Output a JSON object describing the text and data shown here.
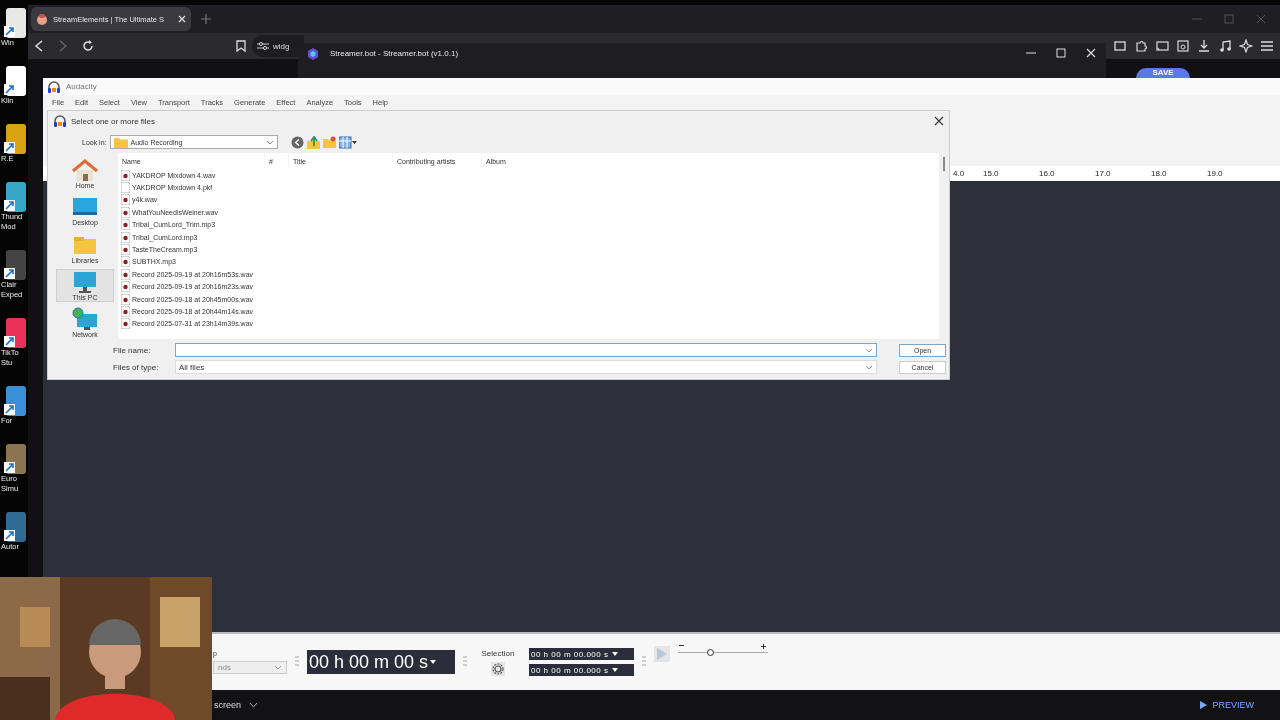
{
  "desktop_icons": [
    {
      "lines": [
        "Win"
      ]
    },
    {
      "lines": [
        "Klin"
      ]
    },
    {
      "lines": [
        "R.E"
      ]
    },
    {
      "lines": [
        "Thund",
        "Mod"
      ]
    },
    {
      "lines": [
        "Clair",
        "Exped"
      ]
    },
    {
      "lines": [
        "TikTo",
        "Stu"
      ]
    },
    {
      "lines": [
        "For"
      ]
    },
    {
      "lines": [
        "Euro",
        "Simu"
      ]
    },
    {
      "lines": [
        "Autor"
      ]
    }
  ],
  "browser": {
    "tab": {
      "title": "StreamElements | The Ultimate S",
      "selected": true
    },
    "address": "widg",
    "save_button": "SAVE",
    "screen_dropdown": "screen",
    "preview_button": "PREVIEW"
  },
  "streamerbot": {
    "title": "Streamer.bot - Streamer.bot (v1.0.1)"
  },
  "audacity": {
    "title": "Audacity",
    "menu": [
      "File",
      "Edit",
      "Select",
      "View",
      "Transport",
      "Tracks",
      "Generate",
      "Effect",
      "Analyze",
      "Tools",
      "Help"
    ],
    "ruler": [
      "4.0",
      "15.0",
      "16.0",
      "17.0",
      "18.0",
      "19.0"
    ],
    "toolbar": {
      "snap_label": "p",
      "snap_value": "nds",
      "time": "00 h 00 m 00 s",
      "selection_label": "Selection",
      "selection_start": "00 h 00 m 00.000 s",
      "selection_end": "00 h 00 m 00.000 s",
      "play_speed": {
        "level": 0.35
      }
    }
  },
  "dialog": {
    "title": "Select one or more files",
    "look_in_label": "Look in:",
    "folder": "Audio Recording",
    "places": [
      {
        "label": "Home",
        "kind": "home",
        "selected": false
      },
      {
        "label": "Desktop",
        "kind": "desktop",
        "selected": false
      },
      {
        "label": "Libraries",
        "kind": "libraries",
        "selected": false
      },
      {
        "label": "This PC",
        "kind": "pc",
        "selected": true
      },
      {
        "label": "Network",
        "kind": "network",
        "selected": false
      }
    ],
    "columns": [
      "Name",
      "#",
      "Title",
      "Contributing artists",
      "Album"
    ],
    "files": [
      {
        "name": "YAKDROP Mixdown 4.wav",
        "kind": "audio"
      },
      {
        "name": "YAKDROP Mixdown 4.pkf",
        "kind": "plain"
      },
      {
        "name": "y4k.wav",
        "kind": "audio"
      },
      {
        "name": "WhatYouNeedisWeiner.wav",
        "kind": "audio"
      },
      {
        "name": "Tribal_CumLord_Trim.mp3",
        "kind": "audio"
      },
      {
        "name": "Tribal_CumLord.mp3",
        "kind": "audio"
      },
      {
        "name": "TasteTheCream.mp3",
        "kind": "audio"
      },
      {
        "name": "SUBTHX.mp3",
        "kind": "audio"
      },
      {
        "name": "Record 2025-09-19 at 20h16m53s.wav",
        "kind": "audio"
      },
      {
        "name": "Record 2025-09-19 at 20h16m23s.wav",
        "kind": "audio"
      },
      {
        "name": "Record 2025-09-18 at 20h45m00s.wav",
        "kind": "audio"
      },
      {
        "name": "Record 2025-09-18 at 20h44m14s.wav",
        "kind": "audio"
      },
      {
        "name": "Record 2025-07-31 at 23h14m39s.wav",
        "kind": "audio"
      }
    ],
    "file_name_label": "File name:",
    "file_type_label": "Files of type:",
    "file_type": "All files",
    "buttons": [
      "Open",
      "Cancel"
    ]
  }
}
